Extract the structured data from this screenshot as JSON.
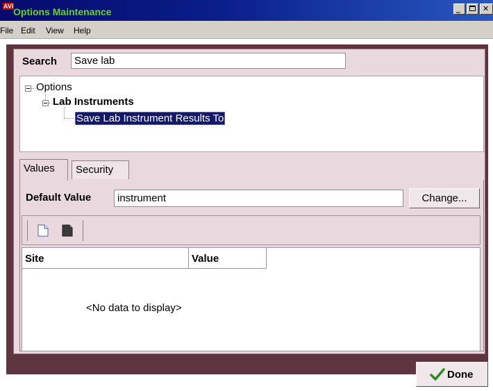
{
  "window": {
    "logo_text": "AVI",
    "title": "Options Maintenance",
    "controls": [
      "minimize",
      "maximize",
      "close"
    ]
  },
  "menu": {
    "items": [
      "File",
      "Edit",
      "View",
      "Help"
    ]
  },
  "search": {
    "label": "Search",
    "value": "Save lab"
  },
  "tree": {
    "root": "Options",
    "child": "Lab Instruments",
    "leaf": "Save Lab Instrument Results To"
  },
  "tabs": [
    {
      "label": "Values",
      "active": true
    },
    {
      "label": "Security",
      "active": false
    }
  ],
  "values_tab": {
    "default_label": "Default Value",
    "default_value": "instrument",
    "change_label": "Change...",
    "toolbar_icons": [
      "new-document-icon",
      "dark-document-icon"
    ],
    "columns": [
      "Site",
      "Value"
    ],
    "empty_text": "<No data to display>"
  },
  "footer": {
    "done_label": "Done"
  },
  "colors": {
    "title_bar": "#0a1e8a",
    "title_text": "#66d51e",
    "frame": "#5e3440",
    "panel": "#e9d8de",
    "selection": "#141868",
    "check": "#2e8b1e"
  }
}
